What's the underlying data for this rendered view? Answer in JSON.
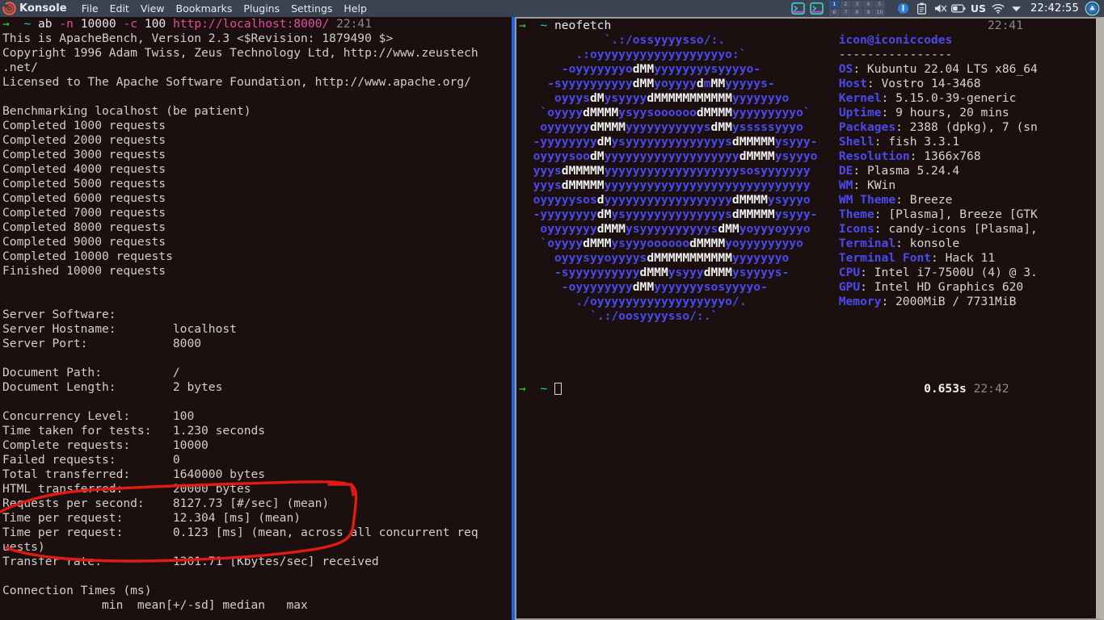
{
  "window": {
    "app_title": "Konsole",
    "icon": "konsole-spiral-icon",
    "menu": [
      "File",
      "Edit",
      "View",
      "Bookmarks",
      "Plugins",
      "Settings",
      "Help"
    ]
  },
  "tray": {
    "icons": [
      "konsole-task-icon",
      "konsole-task-icon-2",
      "pager-icon",
      "info-icon",
      "clipboard-icon",
      "volume-muted-icon",
      "battery-icon",
      "wifi-icon",
      "show-hidden-chevron-icon",
      "user-avatar-icon"
    ],
    "pager_rows": [
      [
        "1",
        "2",
        "3",
        "4",
        "5"
      ],
      [
        "6",
        "7",
        "8",
        "9",
        "10"
      ]
    ],
    "pager_active": "1",
    "keyboard_layout": "US",
    "clock": "22:42:55"
  },
  "left_terminal": {
    "prompt": {
      "arrow": "→",
      "dir": "~",
      "cmd": "ab",
      "flag1": "-n",
      "arg1": "10000",
      "flag2": "-c",
      "arg2": "100",
      "url": "http://localhost:8000/",
      "timestamp": "22:41"
    },
    "output": [
      "This is ApacheBench, Version 2.3 <$Revision: 1879490 $>",
      "Copyright 1996 Adam Twiss, Zeus Technology Ltd, http://www.zeustech",
      ".net/",
      "Licensed to The Apache Software Foundation, http://www.apache.org/",
      "",
      "Benchmarking localhost (be patient)",
      "Completed 1000 requests",
      "Completed 2000 requests",
      "Completed 3000 requests",
      "Completed 4000 requests",
      "Completed 5000 requests",
      "Completed 6000 requests",
      "Completed 7000 requests",
      "Completed 8000 requests",
      "Completed 9000 requests",
      "Completed 10000 requests",
      "Finished 10000 requests",
      "",
      "",
      "Server Software:",
      "Server Hostname:        localhost",
      "Server Port:            8000",
      "",
      "Document Path:          /",
      "Document Length:        2 bytes",
      "",
      "Concurrency Level:      100",
      "Time taken for tests:   1.230 seconds",
      "Complete requests:      10000",
      "Failed requests:        0",
      "Total transferred:      1640000 bytes",
      "HTML transferred:       20000 bytes",
      "Requests per second:    8127.73 [#/sec] (mean)",
      "Time per request:       12.304 [ms] (mean)",
      "Time per request:       0.123 [ms] (mean, across all concurrent req",
      "uests)",
      "Transfer rate:          1301.71 [Kbytes/sec] received",
      "",
      "Connection Times (ms)",
      "              min  mean[+/-sd] median   max"
    ]
  },
  "right_terminal": {
    "prompt": {
      "arrow": "→",
      "dir": "~",
      "cmd": "neofetch",
      "timestamp": "22:41"
    },
    "ascii_art": [
      "            `.:/ossyyyysso/:.",
      "        .:oyyyyyyyyyyyyyyyyyyo:`",
      "      -oyyyyyyyodMMyyyyyyyysyyyyo-",
      "    -syyyyyyyyyydMMyoyyyydmMMyyyyys-",
      "     oyyysdMysyyyydMMMMMMMMMMMyyyyyyyo",
      "   `oyyyydMMMMysyysoooooodMMMMyyyyyyyyyo`",
      "   oyyyyyydMMMMyyyyyyyyyyysdMMysssssyyyo",
      "  -yyyyyyyydMysyyyyyyyyyyyyyysdMMMMMysyyy-",
      "  oyyyysoodMyyyyyyyyyyyyyyyyyyydMMMMysyyyo",
      "  yyysdMMMMMyyyyyyyyyyyyyyyyyyysosyyyyyyy",
      "  yyysdMMMMMyyyyyyyyyyyyyyyyyyyyyyyyyyyyy",
      "  oyyyyysosdyyyyyyyyyyyyyyyyyydMMMMysyyyo",
      "  -yyyyyyyydMysyyyyyyyyyyyyyysdMMMMMysyyy-",
      "   oyyyyyyydMMMysyyyyyyyyyysdMMyoyyyoyyyo",
      "   `oyyyydMMMysyyyoooooodMMMMyoyyyyyyyyo",
      "     oyyysyyoyyyysdMMMMMMMMMMMyyyyyyyo",
      "     -syyyyyyyyyydMMMysyyydMMMysyyyys-",
      "      -oyyyyyyyydMMyyyyyyysosyyyyo-",
      "        ./oyyyyyyyyyyyyyyyyyyo/.",
      "          `.:/oosyyyysso/:.`"
    ],
    "neofetch": {
      "user_host": "icon@iconiccodes",
      "rule": "----------------",
      "entries": [
        {
          "key": "OS",
          "value": "Kubuntu 22.04 LTS x86_64"
        },
        {
          "key": "Host",
          "value": "Vostro 14-3468"
        },
        {
          "key": "Kernel",
          "value": "5.15.0-39-generic"
        },
        {
          "key": "Uptime",
          "value": "9 hours, 20 mins"
        },
        {
          "key": "Packages",
          "value": "2388 (dpkg), 7 (sn"
        },
        {
          "key": "Shell",
          "value": "fish 3.3.1"
        },
        {
          "key": "Resolution",
          "value": "1366x768"
        },
        {
          "key": "DE",
          "value": "Plasma 5.24.4"
        },
        {
          "key": "WM",
          "value": "KWin"
        },
        {
          "key": "WM Theme",
          "value": "Breeze"
        },
        {
          "key": "Theme",
          "value": "[Plasma], Breeze [GTK"
        },
        {
          "key": "Icons",
          "value": "candy-icons [Plasma],"
        },
        {
          "key": "Terminal",
          "value": "konsole"
        },
        {
          "key": "Terminal Font",
          "value": "Hack 11"
        },
        {
          "key": "CPU",
          "value": "Intel i7-7500U (4) @ 3."
        },
        {
          "key": "GPU",
          "value": "Intel HD Graphics 620"
        },
        {
          "key": "Memory",
          "value": "2000MiB / 7731MiB"
        }
      ],
      "palette_row_1": [
        "#1b0f0f",
        "#b41919",
        "#1ba81b",
        "#bf7620",
        "#1a1ab4",
        "#aa1fb4",
        "#1fadb4",
        "#b4b4b4"
      ],
      "palette_row_2": [
        "#6b6b6b",
        "#ff5656",
        "#5eff5e",
        "#ffff5e",
        "#5656ff",
        "#ff56ff",
        "#56ffff",
        "#ffffff"
      ]
    },
    "next_prompt": {
      "arrow": "→",
      "dir": "~",
      "duration": "0.653s",
      "timestamp": "22:42"
    }
  },
  "annotation": {
    "type": "freehand-ellipse",
    "color": "#e01b13",
    "encircles": [
      "Total transferred:      1640000 bytes",
      "HTML transferred:       20000 bytes",
      "Requests per second:    8127.73 [#/sec] (mean)",
      "Time per request:       12.304 [ms] (mean)",
      "Time per request:       0.123 [ms] (mean, across all concurrent req"
    ]
  },
  "colors": {
    "menubar_bg": "#3b4252",
    "terminal_bg": "#1b0f0f",
    "active_border": "#1f60e8",
    "inactive_border": "#9a9a96",
    "prompt_green": "#2dd42d",
    "prompt_cyan": "#1fd0d0",
    "prompt_pink": "#e050a0",
    "neofetch_blue": "#4a4aee",
    "annotation_red": "#e01b13"
  }
}
